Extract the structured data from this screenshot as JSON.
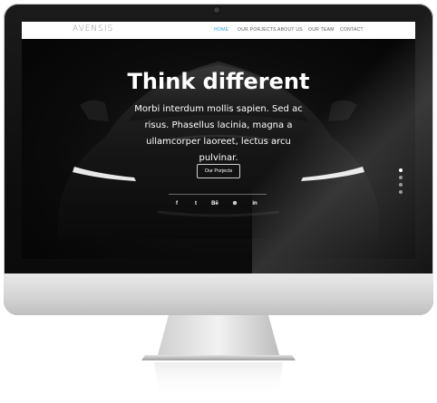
{
  "site": {
    "logo": "AVENSIS"
  },
  "nav": {
    "items": [
      {
        "label": "HOME",
        "active": true
      },
      {
        "label": "OUR PORJECTS",
        "active": false
      },
      {
        "label": "ABOUT US",
        "active": false
      },
      {
        "label": "OUR TEAM",
        "active": false
      },
      {
        "label": "CONTACT",
        "active": false
      }
    ],
    "active_color": "#2aa3cf"
  },
  "hero": {
    "title": "Think different",
    "text": "Morbi interdum mollis sapien. Sed ac risus. Phasellus lacinia, magna a ullamcorper laoreet, lectus arcu pulvinar.",
    "cta_label": "Our Porjects"
  },
  "social": [
    {
      "icon": "facebook-icon",
      "glyph": "f"
    },
    {
      "icon": "twitter-icon",
      "glyph": "t"
    },
    {
      "icon": "behance-icon",
      "glyph": "Bē"
    },
    {
      "icon": "dribbble-icon",
      "glyph": "⊛"
    },
    {
      "icon": "linkedin-icon",
      "glyph": "in"
    }
  ],
  "slider": {
    "count": 4,
    "active_index": 0
  }
}
